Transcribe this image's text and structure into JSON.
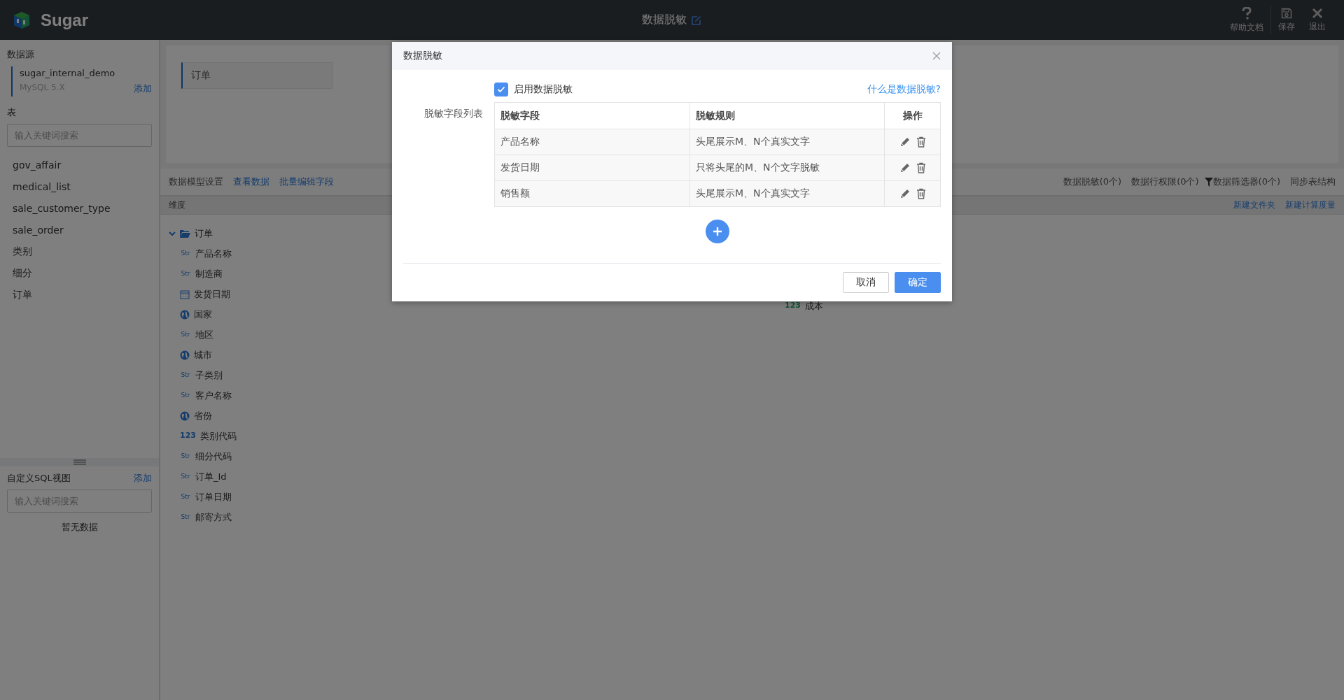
{
  "app": {
    "name": "Sugar",
    "page_title": "数据脱敏"
  },
  "top_actions": [
    {
      "kind": "help",
      "label": "帮助文档"
    },
    {
      "kind": "save",
      "label": "保存"
    },
    {
      "kind": "exit",
      "label": "退出"
    }
  ],
  "sidebar": {
    "source_heading": "数据源",
    "source": {
      "name": "sugar_internal_demo",
      "type": "MySQL 5.X",
      "add": "添加"
    },
    "table_heading": "表",
    "table_search": {
      "placeholder": "输入关键词搜索"
    },
    "tables": [
      "gov_affair",
      "medical_list",
      "sale_customer_type",
      "sale_order",
      "类别",
      "细分",
      "订单"
    ],
    "sql_heading": "自定义SQL视图",
    "sql_add": "添加",
    "sql_search": {
      "placeholder": "输入关键词搜索"
    },
    "sql_empty": "暂无数据"
  },
  "canvas": {
    "tables": [
      "订单"
    ]
  },
  "toolbar": {
    "title": "数据模型设置",
    "links": [
      "查看数据",
      "批量编辑字段"
    ],
    "actions": [
      {
        "kind": "text",
        "label": "数据脱敏(0个)"
      },
      {
        "kind": "text",
        "label": "数据行权限(0个)"
      },
      {
        "kind": "filter",
        "label": "数据筛选器(0个)"
      },
      {
        "kind": "text",
        "label": "同步表结构"
      }
    ]
  },
  "fields_header": {
    "title": "维度",
    "links": [
      "新建文件夹",
      "新建计算度量"
    ]
  },
  "dimensions": {
    "folder": "订单",
    "expanded": true,
    "children": [
      {
        "kind": "str",
        "badge": "Str",
        "label": "产品名称"
      },
      {
        "kind": "str",
        "badge": "Str",
        "label": "制造商"
      },
      {
        "kind": "date",
        "label": "发货日期"
      },
      {
        "kind": "geo",
        "label": "国家"
      },
      {
        "kind": "str",
        "badge": "Str",
        "label": "地区"
      },
      {
        "kind": "geo",
        "label": "城市"
      },
      {
        "kind": "str",
        "badge": "Str",
        "label": "子类别"
      },
      {
        "kind": "str",
        "badge": "Str",
        "label": "客户名称"
      },
      {
        "kind": "geo",
        "label": "省份"
      },
      {
        "kind": "num",
        "badge": "123",
        "label": "类别代码"
      },
      {
        "kind": "str",
        "badge": "Str",
        "label": "细分代码"
      },
      {
        "kind": "str",
        "badge": "Str",
        "label": "订单_Id"
      },
      {
        "kind": "str",
        "badge": "Str",
        "label": "订单日期"
      },
      {
        "kind": "str",
        "badge": "Str",
        "label": "邮寄方式"
      }
    ]
  },
  "measures": [
    {
      "kind": "num",
      "badge": "123",
      "label": "成本"
    }
  ],
  "dialog": {
    "title": "数据脱敏",
    "enable": {
      "label": "启用数据脱敏",
      "checked": true
    },
    "help_link": "什么是数据脱敏?",
    "list_label": "脱敏字段列表",
    "columns": [
      "脱敏字段",
      "脱敏规则",
      "操作"
    ],
    "rows": [
      {
        "field": "产品名称",
        "rule": "头尾展示M、N个真实文字"
      },
      {
        "field": "发货日期",
        "rule": "只将头尾的M、N个文字脱敏"
      },
      {
        "field": "销售额",
        "rule": "头尾展示M、N个真实文字"
      }
    ],
    "buttons": [
      {
        "kind": "secondary",
        "label": "取消"
      },
      {
        "kind": "primary",
        "label": "确定"
      }
    ]
  }
}
